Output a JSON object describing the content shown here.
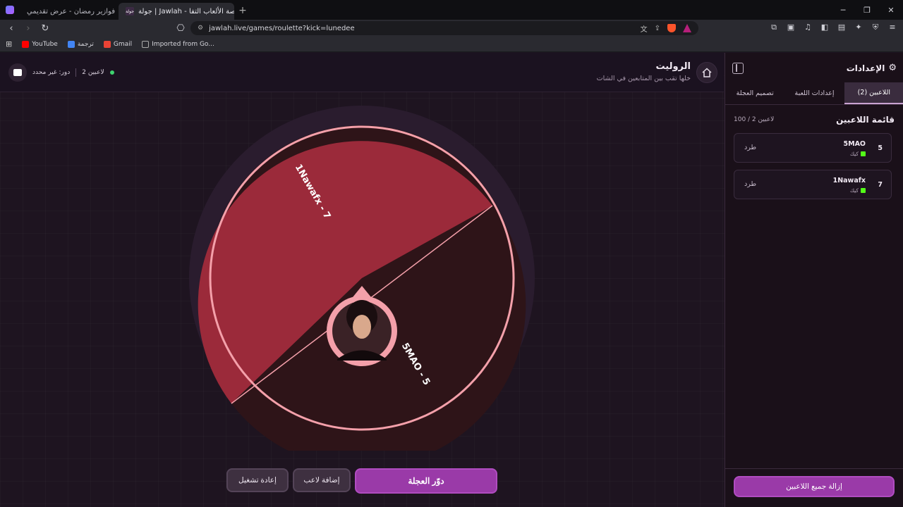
{
  "browser": {
    "tabs": [
      {
        "title": "فوازير رمضان - عرض تقديمي",
        "active": false
      },
      {
        "title": "جولة | Jawlah - منصة الألعاب التفا",
        "favicon": "جولة",
        "active": true
      }
    ],
    "new_tab": "+",
    "url": "jawlah.live/games/roulette?kick=lunedee",
    "bookmarks": [
      {
        "label": "YouTube",
        "color": "#ff0000"
      },
      {
        "label": "ترجمة",
        "color": "#4285f4"
      },
      {
        "label": "Gmail",
        "color": "#ea4335"
      },
      {
        "label": "Imported from Go...",
        "color": "#888888"
      }
    ]
  },
  "header": {
    "title": "الروليت",
    "subtitle": "خلها تقب بين المتابعين في الشات",
    "players_online": "2 لاعبين",
    "role": "دور: غير محدد"
  },
  "wheel": {
    "segments": [
      {
        "label": "1Nawafx - 7",
        "color": "#9b2a3a"
      },
      {
        "label": "5MAO - 5",
        "color": "#2e1418"
      }
    ],
    "rim_color": "#f4a0aa"
  },
  "actions": {
    "spin": "دوّر العجلة",
    "add_player": "إضافة لاعب",
    "reset": "إعادة تشغيل"
  },
  "sidebar": {
    "title": "الإعدادات",
    "tabs": [
      "اللاعبين (2)",
      "إعدادات اللعبة",
      "تصميم العجلة"
    ],
    "list_title": "قائمة اللاعبين",
    "count": "100 / 2 لاعبين",
    "players": [
      {
        "number": "5",
        "name": "5MAO",
        "platform": "كيك",
        "kick": "طرد"
      },
      {
        "number": "7",
        "name": "1Nawafx",
        "platform": "كيك",
        "kick": "طرد"
      }
    ],
    "remove_all": "إزالة جميع اللاعبين"
  },
  "colors": {
    "accent": "#9a3aa8",
    "kick_green": "#53fc18"
  }
}
